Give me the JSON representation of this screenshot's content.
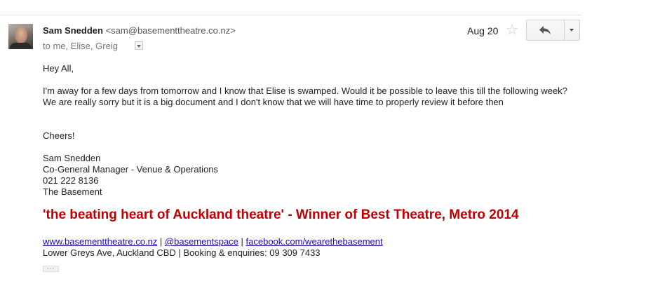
{
  "message": {
    "sender_name": "Sam Snedden",
    "sender_email": "<sam@basementtheatre.co.nz>",
    "recipients": "to me, Elise, Greig",
    "date": "Aug 20",
    "star_icon": "star-icon",
    "reply_icon": "reply-icon",
    "more_icon": "chevron-down-icon"
  },
  "body": {
    "greeting": "Hey All,",
    "paragraph": "I'm away for a few days from tomorrow and I know that Elise is swamped. Would it be possible to leave this till the following week? We are really sorry but it is a big document and I don't know that we will have time to properly review it before then",
    "closing": "Cheers!"
  },
  "signature": {
    "lines": [
      "Sam Snedden",
      "Co-General Manager - Venue & Operations",
      "021 222 8136",
      "The Basement"
    ],
    "tagline": "'the beating heart of Auckland theatre' - Winner of Best Theatre, Metro 2014",
    "links": {
      "website": "www.basementtheatre.co.nz",
      "twitter": "@basementspace",
      "facebook": "facebook.com/wearethebasement",
      "separator": " | "
    },
    "address": "Lower Greys Ave, Auckland CBD | Booking & enquiries: 09 309 7433"
  },
  "trimmed_content_label": "...",
  "colors": {
    "tagline": "#c00000",
    "link": "#1a0dab"
  }
}
